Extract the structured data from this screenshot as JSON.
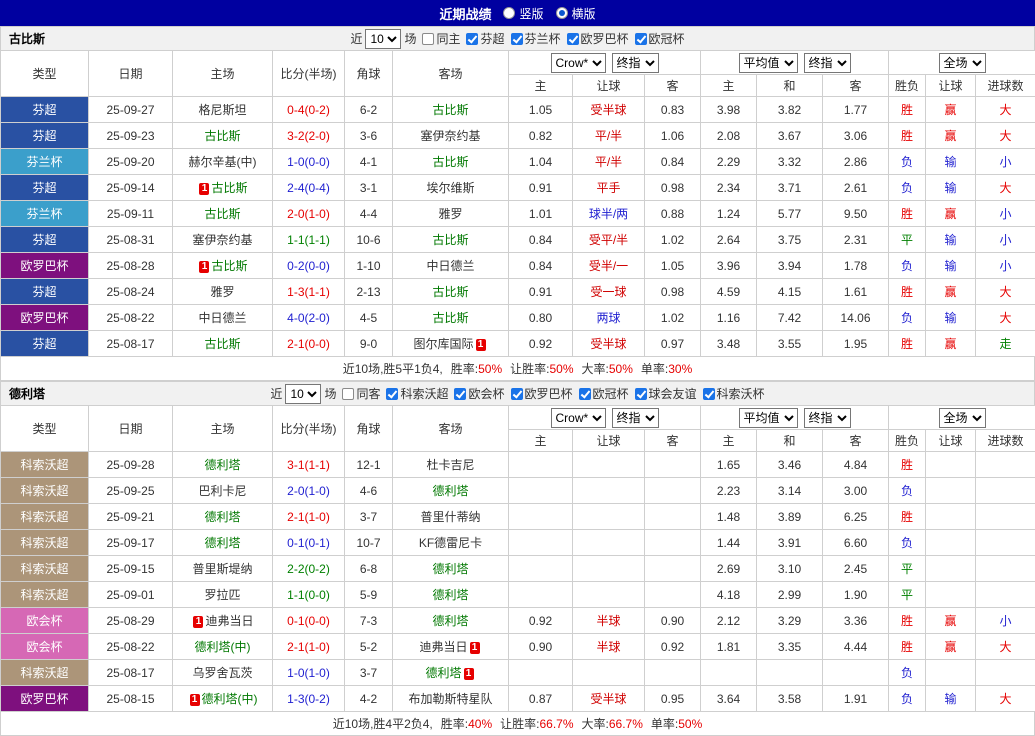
{
  "topbar": {
    "title": "近期战绩",
    "view_options": [
      {
        "label": "竖版",
        "selected": false
      },
      {
        "label": "横版",
        "selected": true
      }
    ]
  },
  "colors": {
    "league": {
      "芬超": "#2951A3",
      "芬兰杯": "#3B9FCB",
      "欧罗巴杯": "#7E107E",
      "科索沃超": "#AC9579",
      "欧会杯": "#D668B5"
    },
    "outcome": {
      "胜": "#E60000",
      "平": "#008000",
      "负": "#1F1FD0",
      "赢": "#E60000",
      "输": "#1F1FD0",
      "走": "#008000",
      "大": "#E60000",
      "小": "#1F1FD0"
    },
    "focus_team": "#007800",
    "handicap_red": "#D00000",
    "handicap_blue": "#1F1FD0",
    "topbar_bg": "#0000A0"
  },
  "table_header": {
    "fixed_columns": [
      "类型",
      "日期",
      "主场",
      "比分(半场)",
      "角球",
      "客场"
    ],
    "odds_sub": [
      "主",
      "让球",
      "客"
    ],
    "avg_sub": [
      "主",
      "和",
      "客"
    ],
    "result_sub": [
      "胜负",
      "让球",
      "进球数"
    ]
  },
  "sections": [
    {
      "team": "古比斯",
      "filter": {
        "near": "近",
        "count": "10",
        "unit": "场",
        "same_venue": {
          "label": "同主",
          "checked": false
        },
        "competitions": [
          {
            "label": "芬超",
            "checked": true
          },
          {
            "label": "芬兰杯",
            "checked": true
          },
          {
            "label": "欧罗巴杯",
            "checked": true
          },
          {
            "label": "欧冠杯",
            "checked": true
          }
        ]
      },
      "selects": {
        "bookmaker": "Crow*",
        "book_stage": "终指",
        "average": "平均值",
        "avg_stage": "终指",
        "scope": "全场"
      },
      "rows": [
        {
          "league": "芬超",
          "date": "25-09-27",
          "home": "格尼斯坦",
          "home_focus": false,
          "home_cards": 0,
          "score": "0-4(0-2)",
          "corner": "6-2",
          "away": "古比斯",
          "away_focus": true,
          "away_cards": 0,
          "odds": [
            "1.05",
            "受半球",
            "0.83"
          ],
          "handicap_tone": "red",
          "avg": [
            "3.98",
            "3.82",
            "1.77"
          ],
          "results": [
            "胜",
            "赢",
            "大"
          ]
        },
        {
          "league": "芬超",
          "date": "25-09-23",
          "home": "古比斯",
          "home_focus": true,
          "home_cards": 0,
          "score": "3-2(2-0)",
          "corner": "3-6",
          "away": "塞伊奈约基",
          "away_focus": false,
          "away_cards": 0,
          "odds": [
            "0.82",
            "平/半",
            "1.06"
          ],
          "handicap_tone": "red",
          "avg": [
            "2.08",
            "3.67",
            "3.06"
          ],
          "results": [
            "胜",
            "赢",
            "大"
          ]
        },
        {
          "league": "芬兰杯",
          "date": "25-09-20",
          "home": "赫尔辛基(中)",
          "home_focus": false,
          "home_cards": 0,
          "score": "1-0(0-0)",
          "corner": "4-1",
          "away": "古比斯",
          "away_focus": true,
          "away_cards": 0,
          "odds": [
            "1.04",
            "平/半",
            "0.84"
          ],
          "handicap_tone": "red",
          "avg": [
            "2.29",
            "3.32",
            "2.86"
          ],
          "results": [
            "负",
            "输",
            "小"
          ]
        },
        {
          "league": "芬超",
          "date": "25-09-14",
          "home": "古比斯",
          "home_focus": true,
          "home_cards": 1,
          "score": "2-4(0-4)",
          "corner": "3-1",
          "away": "埃尔维斯",
          "away_focus": false,
          "away_cards": 0,
          "odds": [
            "0.91",
            "平手",
            "0.98"
          ],
          "handicap_tone": "red",
          "avg": [
            "2.34",
            "3.71",
            "2.61"
          ],
          "results": [
            "负",
            "输",
            "大"
          ]
        },
        {
          "league": "芬兰杯",
          "date": "25-09-11",
          "home": "古比斯",
          "home_focus": true,
          "home_cards": 0,
          "score": "2-0(1-0)",
          "corner": "4-4",
          "away": "雅罗",
          "away_focus": false,
          "away_cards": 0,
          "odds": [
            "1.01",
            "球半/两",
            "0.88"
          ],
          "handicap_tone": "blue",
          "avg": [
            "1.24",
            "5.77",
            "9.50"
          ],
          "results": [
            "胜",
            "赢",
            "小"
          ]
        },
        {
          "league": "芬超",
          "date": "25-08-31",
          "home": "塞伊奈约基",
          "home_focus": false,
          "home_cards": 0,
          "score": "1-1(1-1)",
          "corner": "10-6",
          "away": "古比斯",
          "away_focus": true,
          "away_cards": 0,
          "odds": [
            "0.84",
            "受平/半",
            "1.02"
          ],
          "handicap_tone": "red",
          "avg": [
            "2.64",
            "3.75",
            "2.31"
          ],
          "results": [
            "平",
            "输",
            "小"
          ]
        },
        {
          "league": "欧罗巴杯",
          "date": "25-08-28",
          "home": "古比斯",
          "home_focus": true,
          "home_cards": 1,
          "score": "0-2(0-0)",
          "corner": "1-10",
          "away": "中日德兰",
          "away_focus": false,
          "away_cards": 0,
          "odds": [
            "0.84",
            "受半/一",
            "1.05"
          ],
          "handicap_tone": "red",
          "avg": [
            "3.96",
            "3.94",
            "1.78"
          ],
          "results": [
            "负",
            "输",
            "小"
          ]
        },
        {
          "league": "芬超",
          "date": "25-08-24",
          "home": "雅罗",
          "home_focus": false,
          "home_cards": 0,
          "score": "1-3(1-1)",
          "corner": "2-13",
          "away": "古比斯",
          "away_focus": true,
          "away_cards": 0,
          "odds": [
            "0.91",
            "受一球",
            "0.98"
          ],
          "handicap_tone": "red",
          "avg": [
            "4.59",
            "4.15",
            "1.61"
          ],
          "results": [
            "胜",
            "赢",
            "大"
          ]
        },
        {
          "league": "欧罗巴杯",
          "date": "25-08-22",
          "home": "中日德兰",
          "home_focus": false,
          "home_cards": 0,
          "score": "4-0(2-0)",
          "corner": "4-5",
          "away": "古比斯",
          "away_focus": true,
          "away_cards": 0,
          "odds": [
            "0.80",
            "两球",
            "1.02"
          ],
          "handicap_tone": "blue",
          "avg": [
            "1.16",
            "7.42",
            "14.06"
          ],
          "results": [
            "负",
            "输",
            "大"
          ]
        },
        {
          "league": "芬超",
          "date": "25-08-17",
          "home": "古比斯",
          "home_focus": true,
          "home_cards": 0,
          "score": "2-1(0-0)",
          "corner": "9-0",
          "away": "图尔库国际",
          "away_focus": false,
          "away_cards": 1,
          "odds": [
            "0.92",
            "受半球",
            "0.97"
          ],
          "handicap_tone": "red",
          "avg": [
            "3.48",
            "3.55",
            "1.95"
          ],
          "results": [
            "胜",
            "赢",
            "走"
          ]
        }
      ],
      "summary": {
        "text": "近10场,胜5平1负4, ",
        "stats": [
          [
            "胜率:",
            "50%"
          ],
          [
            "让胜率:",
            "50%"
          ],
          [
            "大率:",
            "50%"
          ],
          [
            "单率:",
            "30%"
          ]
        ]
      }
    },
    {
      "team": "德利塔",
      "filter": {
        "near": "近",
        "count": "10",
        "unit": "场",
        "same_venue": {
          "label": "同客",
          "checked": false
        },
        "competitions": [
          {
            "label": "科索沃超",
            "checked": true
          },
          {
            "label": "欧会杯",
            "checked": true
          },
          {
            "label": "欧罗巴杯",
            "checked": true
          },
          {
            "label": "欧冠杯",
            "checked": true
          },
          {
            "label": "球会友谊",
            "checked": true
          },
          {
            "label": "科索沃杯",
            "checked": true
          }
        ]
      },
      "selects": {
        "bookmaker": "Crow*",
        "book_stage": "终指",
        "average": "平均值",
        "avg_stage": "终指",
        "scope": "全场"
      },
      "rows": [
        {
          "league": "科索沃超",
          "date": "25-09-28",
          "home": "德利塔",
          "home_focus": true,
          "home_cards": 0,
          "score": "3-1(1-1)",
          "corner": "12-1",
          "away": "杜卡吉尼",
          "away_focus": false,
          "away_cards": 0,
          "odds": [
            "",
            "",
            ""
          ],
          "avg": [
            "1.65",
            "3.46",
            "4.84"
          ],
          "results": [
            "胜",
            "",
            ""
          ]
        },
        {
          "league": "科索沃超",
          "date": "25-09-25",
          "home": "巴利卡尼",
          "home_focus": false,
          "home_cards": 0,
          "score": "2-0(1-0)",
          "corner": "4-6",
          "away": "德利塔",
          "away_focus": true,
          "away_cards": 0,
          "odds": [
            "",
            "",
            ""
          ],
          "avg": [
            "2.23",
            "3.14",
            "3.00"
          ],
          "results": [
            "负",
            "",
            ""
          ]
        },
        {
          "league": "科索沃超",
          "date": "25-09-21",
          "home": "德利塔",
          "home_focus": true,
          "home_cards": 0,
          "score": "2-1(1-0)",
          "corner": "3-7",
          "away": "普里什蒂纳",
          "away_focus": false,
          "away_cards": 0,
          "odds": [
            "",
            "",
            ""
          ],
          "avg": [
            "1.48",
            "3.89",
            "6.25"
          ],
          "results": [
            "胜",
            "",
            ""
          ]
        },
        {
          "league": "科索沃超",
          "date": "25-09-17",
          "home": "德利塔",
          "home_focus": true,
          "home_cards": 0,
          "score": "0-1(0-1)",
          "corner": "10-7",
          "away": "KF德雷尼卡",
          "away_focus": false,
          "away_cards": 0,
          "odds": [
            "",
            "",
            ""
          ],
          "avg": [
            "1.44",
            "3.91",
            "6.60"
          ],
          "results": [
            "负",
            "",
            ""
          ]
        },
        {
          "league": "科索沃超",
          "date": "25-09-15",
          "home": "普里斯堤纳",
          "home_focus": false,
          "home_cards": 0,
          "score": "2-2(0-2)",
          "corner": "6-8",
          "away": "德利塔",
          "away_focus": true,
          "away_cards": 0,
          "odds": [
            "",
            "",
            ""
          ],
          "avg": [
            "2.69",
            "3.10",
            "2.45"
          ],
          "results": [
            "平",
            "",
            ""
          ]
        },
        {
          "league": "科索沃超",
          "date": "25-09-01",
          "home": "罗拉匹",
          "home_focus": false,
          "home_cards": 0,
          "score": "1-1(0-0)",
          "corner": "5-9",
          "away": "德利塔",
          "away_focus": true,
          "away_cards": 0,
          "odds": [
            "",
            "",
            ""
          ],
          "avg": [
            "4.18",
            "2.99",
            "1.90"
          ],
          "results": [
            "平",
            "",
            ""
          ]
        },
        {
          "league": "欧会杯",
          "date": "25-08-29",
          "home": "迪弗当日",
          "home_focus": false,
          "home_cards": 1,
          "score": "0-1(0-0)",
          "corner": "7-3",
          "away": "德利塔",
          "away_focus": true,
          "away_cards": 0,
          "odds": [
            "0.92",
            "半球",
            "0.90"
          ],
          "handicap_tone": "red",
          "avg": [
            "2.12",
            "3.29",
            "3.36"
          ],
          "results": [
            "胜",
            "赢",
            "小"
          ]
        },
        {
          "league": "欧会杯",
          "date": "25-08-22",
          "home": "德利塔(中)",
          "home_focus": true,
          "home_cards": 0,
          "score": "2-1(1-0)",
          "corner": "5-2",
          "away": "迪弗当日",
          "away_focus": false,
          "away_cards": 1,
          "odds": [
            "0.90",
            "半球",
            "0.92"
          ],
          "handicap_tone": "red",
          "avg": [
            "1.81",
            "3.35",
            "4.44"
          ],
          "results": [
            "胜",
            "赢",
            "大"
          ]
        },
        {
          "league": "科索沃超",
          "date": "25-08-17",
          "home": "乌罗舍瓦茨",
          "home_focus": false,
          "home_cards": 0,
          "score": "1-0(1-0)",
          "corner": "3-7",
          "away": "德利塔",
          "away_focus": true,
          "away_cards": 1,
          "odds": [
            "",
            "",
            ""
          ],
          "avg": [
            "",
            "",
            ""
          ],
          "results": [
            "负",
            "",
            ""
          ]
        },
        {
          "league": "欧罗巴杯",
          "date": "25-08-15",
          "home": "德利塔(中)",
          "home_focus": true,
          "home_cards": 1,
          "score": "1-3(0-2)",
          "corner": "4-2",
          "away": "布加勒斯特星队",
          "away_focus": false,
          "away_cards": 0,
          "odds": [
            "0.87",
            "受半球",
            "0.95"
          ],
          "handicap_tone": "red",
          "avg": [
            "3.64",
            "3.58",
            "1.91"
          ],
          "results": [
            "负",
            "输",
            "大"
          ]
        }
      ],
      "summary": {
        "text": "近10场,胜4平2负4, ",
        "stats": [
          [
            "胜率:",
            "40%"
          ],
          [
            "让胜率:",
            "66.7%"
          ],
          [
            "大率:",
            "66.7%"
          ],
          [
            "单率:",
            "50%"
          ]
        ]
      }
    }
  ]
}
